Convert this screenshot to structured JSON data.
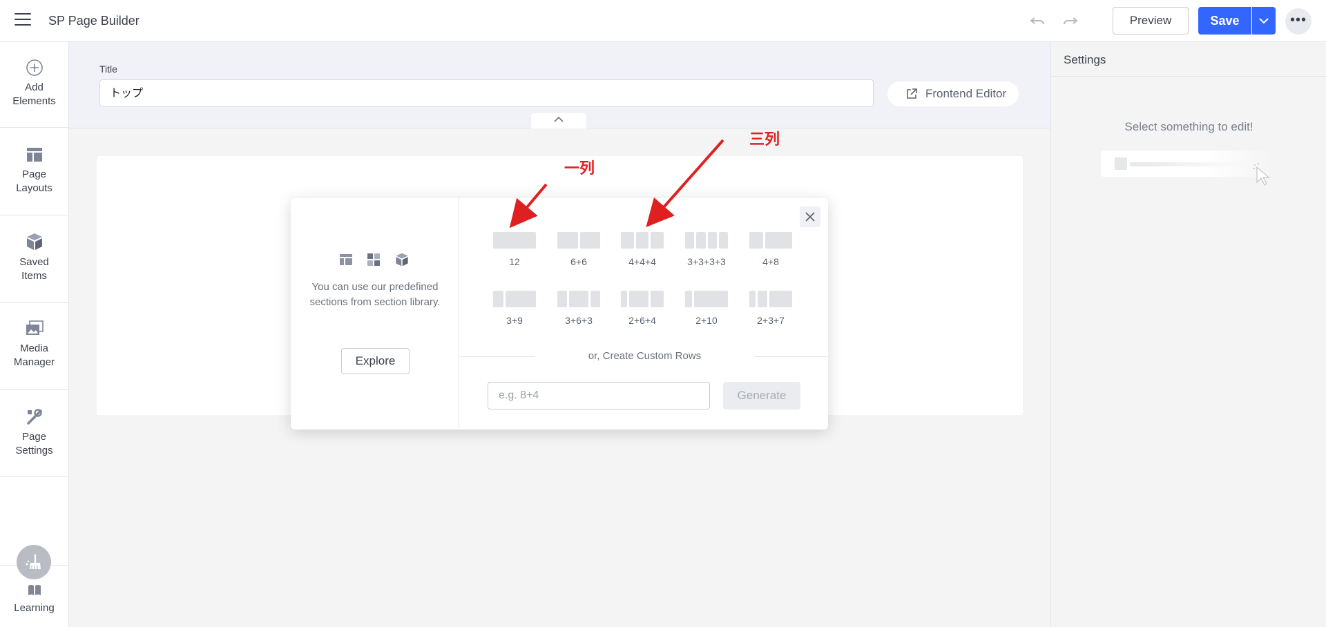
{
  "app": {
    "title": "SP Page Builder"
  },
  "toolbar": {
    "undo_icon": "undo-icon",
    "redo_icon": "redo-icon",
    "preview_label": "Preview",
    "save_label": "Save",
    "more_label": "•••"
  },
  "sidebar": {
    "items": [
      {
        "label_line1": "Add",
        "label_line2": "Elements",
        "icon": "plus-circle-icon"
      },
      {
        "label_line1": "Page",
        "label_line2": "Layouts",
        "icon": "layout-icon"
      },
      {
        "label_line1": "Saved",
        "label_line2": "Items",
        "icon": "cube-icon"
      },
      {
        "label_line1": "Media",
        "label_line2": "Manager",
        "icon": "images-icon"
      },
      {
        "label_line1": "Page",
        "label_line2": "Settings",
        "icon": "tools-icon"
      },
      {
        "label_line1": "Learning",
        "label_line2": "",
        "icon": "book-icon"
      }
    ]
  },
  "page": {
    "title_label": "Title",
    "title_value": "トップ",
    "frontend_editor_label": "Frontend Editor"
  },
  "settings": {
    "heading": "Settings",
    "empty_text": "Select something to edit!"
  },
  "modal": {
    "library_text": "You can use our predefined sections from section library.",
    "explore_label": "Explore",
    "layouts": [
      {
        "label": "12",
        "cols": [
          12
        ]
      },
      {
        "label": "6+6",
        "cols": [
          6,
          6
        ]
      },
      {
        "label": "4+4+4",
        "cols": [
          4,
          4,
          4
        ]
      },
      {
        "label": "3+3+3+3",
        "cols": [
          3,
          3,
          3,
          3
        ]
      },
      {
        "label": "4+8",
        "cols": [
          4,
          8
        ]
      },
      {
        "label": "3+9",
        "cols": [
          3,
          9
        ]
      },
      {
        "label": "3+6+3",
        "cols": [
          3,
          6,
          3
        ]
      },
      {
        "label": "2+6+4",
        "cols": [
          2,
          6,
          4
        ]
      },
      {
        "label": "2+10",
        "cols": [
          2,
          10
        ]
      },
      {
        "label": "2+3+7",
        "cols": [
          2,
          3,
          7
        ]
      }
    ],
    "custom_rows_label": "or, Create Custom Rows",
    "custom_placeholder": "e.g. 8+4",
    "generate_label": "Generate"
  },
  "annotations": {
    "one_column": "一列",
    "three_columns": "三列",
    "color": "#e02020"
  },
  "colors": {
    "accent": "#3366ff",
    "sidebar_icon": "#7d8596"
  }
}
